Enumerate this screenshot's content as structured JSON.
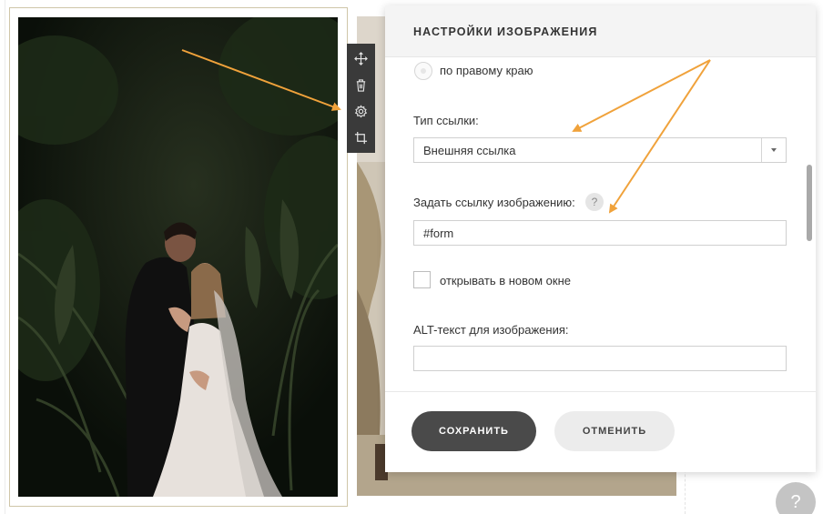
{
  "dialog": {
    "title": "НАСТРОЙКИ ИЗОБРАЖЕНИЯ",
    "align_right_label": "по правому краю",
    "link_type_label": "Тип ссылки:",
    "link_type_value": "Внешняя ссылка",
    "set_link_label": "Задать ссылку изображению:",
    "help_symbol": "?",
    "link_value": "#form",
    "new_window_label": "открывать в новом окне",
    "alt_label": "ALT-текст для изображения:",
    "alt_value": "",
    "save_label": "СОХРАНИТЬ",
    "cancel_label": "ОТМЕНИТЬ"
  },
  "toolbar": {
    "icons": [
      "move-icon",
      "trash-icon",
      "gear-icon",
      "crop-icon"
    ]
  },
  "help_fab": {
    "symbol": "?"
  },
  "colors": {
    "annotation_arrow": "#f0a23b",
    "toolbar_bg": "#3a3a3a",
    "save_button": "#4a4a4a",
    "cancel_button": "#ececec"
  }
}
